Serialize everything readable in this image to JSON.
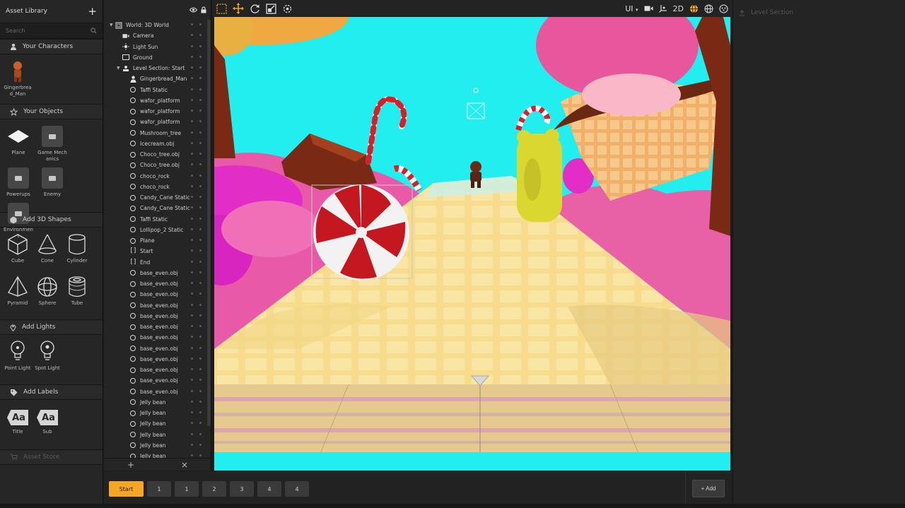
{
  "asset_library": {
    "title": "Asset Library",
    "add_symbol": "+",
    "search_placeholder": "Search",
    "sections": {
      "characters": "Your Characters",
      "objects": "Your Objects",
      "shapes": "Add 3D Shapes",
      "lights": "Add Lights",
      "labels": "Add Labels",
      "store": "Asset Store"
    },
    "characters": [
      {
        "label": "Gingerbread_Man"
      }
    ],
    "objects": [
      {
        "label": "Plane"
      },
      {
        "label": "Game Mechanics"
      },
      {
        "label": "Powerups"
      },
      {
        "label": "Enemy"
      },
      {
        "label": "Environment"
      }
    ],
    "shapes": [
      {
        "label": "Cube"
      },
      {
        "label": "Cone"
      },
      {
        "label": "Cylinder"
      },
      {
        "label": "Pyramid"
      },
      {
        "label": "Sphere"
      },
      {
        "label": "Tube"
      }
    ],
    "lights": [
      {
        "label": "Point Light"
      },
      {
        "label": "Spot Light"
      }
    ],
    "labels": [
      {
        "label": "Title",
        "glyph": "Aa"
      },
      {
        "label": "Sub",
        "glyph": "Aa"
      }
    ]
  },
  "hierarchy": {
    "items": [
      {
        "label": "World: 3D World",
        "icon": "world",
        "indent": 0,
        "arrow": true
      },
      {
        "label": "Camera",
        "icon": "camera",
        "indent": 1
      },
      {
        "label": "Light Sun",
        "icon": "sun",
        "indent": 1
      },
      {
        "label": "Ground",
        "icon": "ground",
        "indent": 1
      },
      {
        "label": "Level Section: Start",
        "icon": "level",
        "indent": 1,
        "arrow": true
      },
      {
        "label": "Gingerbread_Man",
        "icon": "person",
        "indent": 2
      },
      {
        "label": "Taffi Static",
        "icon": "object",
        "indent": 2
      },
      {
        "label": "wafor_platform",
        "icon": "object",
        "indent": 2
      },
      {
        "label": "wafor_platform",
        "icon": "object",
        "indent": 2
      },
      {
        "label": "wafor_platform",
        "icon": "object",
        "indent": 2
      },
      {
        "label": "Mushroom_tree",
        "icon": "object",
        "indent": 2
      },
      {
        "label": "Icecream.obj",
        "icon": "object",
        "indent": 2
      },
      {
        "label": "Choco_tree.obj",
        "icon": "object",
        "indent": 2
      },
      {
        "label": "Choco_tree.obj",
        "icon": "object",
        "indent": 2
      },
      {
        "label": "choco_rock",
        "icon": "object",
        "indent": 2
      },
      {
        "label": "choco_rock",
        "icon": "object",
        "indent": 2
      },
      {
        "label": "Candy_Cane Static",
        "icon": "object",
        "indent": 2
      },
      {
        "label": "Candy_Cane Static",
        "icon": "object",
        "indent": 2
      },
      {
        "label": "Taffi Static",
        "icon": "object",
        "indent": 2
      },
      {
        "label": "Lollipop_2 Static",
        "icon": "object",
        "indent": 2
      },
      {
        "label": "Plane",
        "icon": "object",
        "indent": 2
      },
      {
        "label": "Start",
        "icon": "bracket",
        "indent": 2
      },
      {
        "label": "End",
        "icon": "bracket",
        "indent": 2
      },
      {
        "label": "base_even.obj",
        "icon": "object",
        "indent": 2
      },
      {
        "label": "base_even.obj",
        "icon": "object",
        "indent": 2
      },
      {
        "label": "base_even.obj",
        "icon": "object",
        "indent": 2
      },
      {
        "label": "base_even.obj",
        "icon": "object",
        "indent": 2
      },
      {
        "label": "base_even.obj",
        "icon": "object",
        "indent": 2
      },
      {
        "label": "base_even.obj",
        "icon": "object",
        "indent": 2
      },
      {
        "label": "base_even.obj",
        "icon": "object",
        "indent": 2
      },
      {
        "label": "base_even.obj",
        "icon": "object",
        "indent": 2
      },
      {
        "label": "base_even.obj",
        "icon": "object",
        "indent": 2
      },
      {
        "label": "base_even.obj",
        "icon": "object",
        "indent": 2
      },
      {
        "label": "base_even.obj",
        "icon": "object",
        "indent": 2
      },
      {
        "label": "base_even.obj",
        "icon": "object",
        "indent": 2
      },
      {
        "label": "Jelly bean",
        "icon": "object",
        "indent": 2
      },
      {
        "label": "Jelly bean",
        "icon": "object",
        "indent": 2
      },
      {
        "label": "Jelly bean",
        "icon": "object",
        "indent": 2
      },
      {
        "label": "Jelly bean",
        "icon": "object",
        "indent": 2
      },
      {
        "label": "Jelly bean",
        "icon": "object",
        "indent": 2
      },
      {
        "label": "Jelly bean",
        "icon": "object",
        "indent": 2
      }
    ],
    "footer_add": "+",
    "footer_remove": "×"
  },
  "toolbar": {
    "ui_label": "UI",
    "mode_label": "2D"
  },
  "right_panel": {
    "title": "Level Section"
  },
  "level_tabs": [
    "Start",
    "1",
    "1",
    "2",
    "3",
    "4",
    "4"
  ],
  "add_button": "+ Add",
  "colors": {
    "accent": "#f5a623",
    "sky": "#1ff0f0",
    "panel": "#262626"
  }
}
